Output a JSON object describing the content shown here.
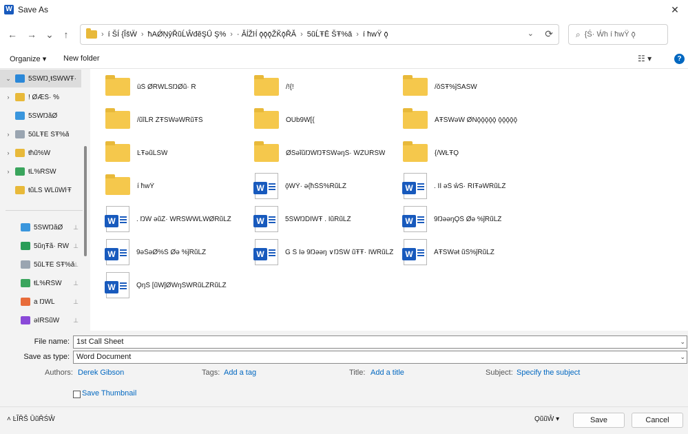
{
  "window": {
    "title": "Save As",
    "app_icon_letter": "W",
    "close_glyph": "✕"
  },
  "nav": {
    "back_glyph": "←",
    "forward_glyph": "→",
    "recent_glyph": "⌄",
    "up_glyph": "↑",
    "path_segments": [
      "í ŠÍ {ǏšẄ",
      "ħAǾŅŷŘũĹŴđẽŞǗ Ş%",
      "· ǍĺŽŀĺ ǭǭǭŽǨǭŘǍ",
      "5ũĹŦĒ ŠŦ%ǎ",
      "í ħwŸ ǭ"
    ],
    "refresh_glyph": "⟳",
    "search_placeholder": "{Ś· Ẃh í ħwŸ ǭ"
  },
  "commands": {
    "organize": "Organize ▾",
    "new_folder": "New folder",
    "view_glyph": "☷ ▾",
    "help_glyph": "?"
  },
  "sidebar": {
    "items": [
      {
        "label": "5ŚŴŊ¸ŧŚŴŴŦ·",
        "chev": "⌄",
        "color": "#2b88d8",
        "selected": true
      },
      {
        "label": "! ǾǼŠ· %",
        "chev": "›",
        "color": "#e8b93a"
      },
      {
        "label": "5ŚŴŊãǾ",
        "chev": "",
        "color": "#3a96dd"
      },
      {
        "label": "5ũĹŦĒ ŠŦ%ǎ",
        "chev": "›",
        "color": "#9aa5b1"
      },
      {
        "label": "ŧħũ%Ŵ",
        "chev": "›",
        "color": "#e8b93a"
      },
      {
        "label": "ŧĹ%ŘŠŴ",
        "chev": "›",
        "color": "#3aa55d"
      },
      {
        "label": "ŧũĹŠ ŴĹũŴŀŦ",
        "chev": "",
        "color": "#e8b93a"
      }
    ],
    "pinned": [
      {
        "label": "5ŚŴŊãǾ",
        "color": "#3a96dd"
      },
      {
        "label": "5ũŋŦã· ŘŴ",
        "color": "#2a9d58"
      },
      {
        "label": "5ũĹŦĒ ŠŦ%ǎ",
        "color": "#9aa5b1"
      },
      {
        "label": "ŧĹ%ŘŠŴ",
        "color": "#3aa55d"
      },
      {
        "label": "a ŊŴĹ",
        "color": "#e86c3a"
      },
      {
        "label": "ǝĨŘŚũŴ",
        "color": "#8a4ad8"
      }
    ],
    "pin_glyph": "📌"
  },
  "files": [
    {
      "name": "ǜŠ ǾŘŴĹŚŊǾũ· Ř",
      "type": "folder"
    },
    {
      "name": "/!{!",
      "type": "folder"
    },
    {
      "name": "/ǒŠŦ%ǰŠAŚŴ",
      "type": "folder"
    },
    {
      "name": "/ũĩĹŘ ŽŦŚŴǝŴŘũŦŠ",
      "type": "folder"
    },
    {
      "name": "ǑŨb9Ŵ[{",
      "type": "folder"
    },
    {
      "name": "ǍŦŚŴǝŴ ǾǸǭǭǭǭǭ ǭǭǭǭǭ",
      "type": "folder"
    },
    {
      "name": "ĿŦǝũĹŚŴ",
      "type": "folder"
    },
    {
      "name": "ǾŚǝĩũŊŴŊŦŚŴǝŋŚ· ŴŽŨŘŚŴ",
      "type": "folder"
    },
    {
      "name": "{/ŴŁŦǪ",
      "type": "folder"
    },
    {
      "name": "í ħwŸ",
      "type": "folder"
    },
    {
      "name": "ǭŴŸ· ǝ{ħŠŠ%ŘũĹŽ",
      "type": "doc"
    },
    {
      "name": ". ĨǏ ǝŠ ŵŠ· ŘĨŦǝŴŘũĹŽ",
      "type": "doc"
    },
    {
      "name": ". ŊŴ ǝũŽ· ŴŘŚŴŴĹŴǾŘũĹŽ",
      "type": "doc"
    },
    {
      "name": "5ŚŴŊĎĨŴŦ . ĨũŘũĹŽ",
      "type": "doc"
    },
    {
      "name": "9ŊǝǝŋǪŠ Ǿǝ %ǰŘũĹŽ",
      "type": "doc"
    },
    {
      "name": "9ǝŠǝǾ%Š Ǿǝ %ǰŘũĹŽ",
      "type": "doc"
    },
    {
      "name": "Ǵ Š Ĩǝ 9Ŋǝǝŋ ∨ŊŠŴ ũŦŦ· ĨŴŘũĹŽ",
      "type": "doc"
    },
    {
      "name": "ǍŦŚŴǝŧ ũŠ%ǰŘũĹŽ",
      "type": "doc"
    },
    {
      "name": "ǪŋŠ [ũŴǰǾŴŋŠŴŘũĹŽŘũĹŽ",
      "type": "doc"
    }
  ],
  "form": {
    "file_name_label": "File name:",
    "file_name_value": "1st Call Sheet",
    "save_type_label": "Save as type:",
    "save_type_value": "Word Document",
    "authors_label": "Authors:",
    "authors_value": "Derek Gibson",
    "tags_label": "Tags:",
    "tags_value": "Add a tag",
    "title_label": "Title:",
    "title_value": "Add a title",
    "subject_label": "Subject:",
    "subject_value": "Specify the subject",
    "thumbnail_label": "Save Thumbnail"
  },
  "footer": {
    "hide_folders": "˄  ĿĨŘŠ ǛũŘŚŴ",
    "tools": "ǪũũŴ  ▾",
    "save": "Save",
    "cancel": "Cancel"
  }
}
